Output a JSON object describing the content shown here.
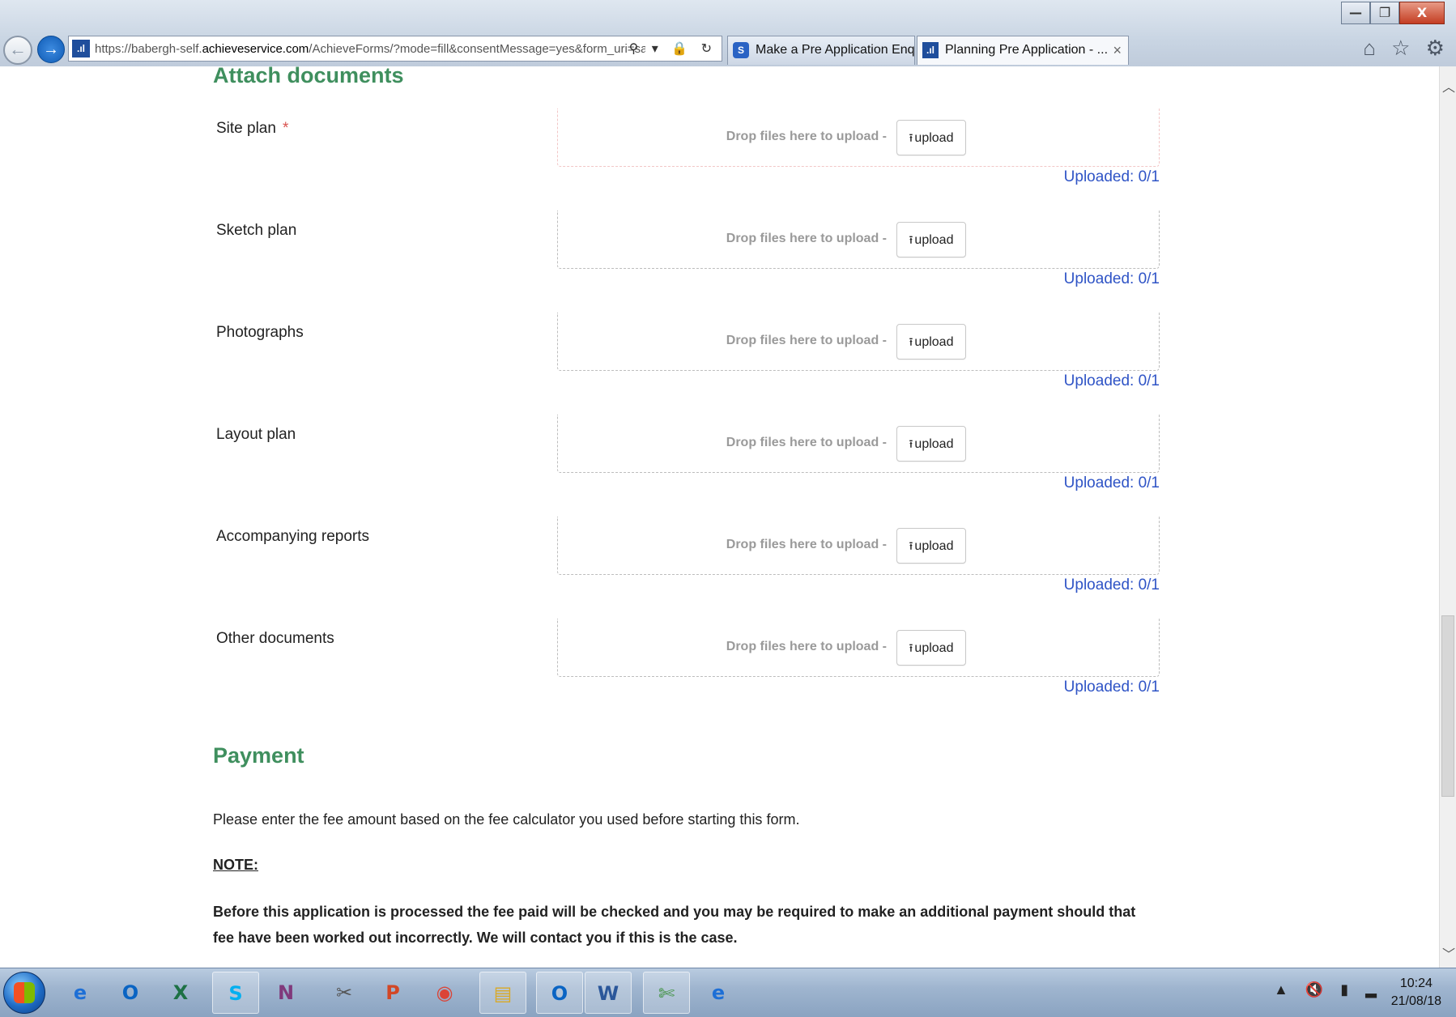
{
  "browser": {
    "url_prefix": "https://babergh-self.",
    "url_domain": "achieveservice.com",
    "url_rest": "/AchieveForms/?mode=fill&consentMessage=yes&form_uri=sandbox",
    "address_tools": "⚲ ▾ 🔒 ↻",
    "tabs": [
      {
        "label": "Make a Pre Application Enquir...",
        "icon": "s-logo-icon"
      },
      {
        "label": "Planning Pre Application - ...",
        "icon": "bar-logo-icon",
        "close": "×"
      }
    ],
    "window_controls": {
      "minimize": "—",
      "restore": "❐",
      "close": "X"
    },
    "toolbar_icons": "⌂ ☆ ⚙"
  },
  "form": {
    "attach_title": "Attach documents",
    "drop_text": "Drop files here to upload -",
    "upload_label": "upload",
    "upload_icon": "⭱",
    "required_mark": "*",
    "fields": [
      {
        "label": "Site plan",
        "required": true,
        "status": "Uploaded: 0/1"
      },
      {
        "label": "Sketch plan",
        "required": false,
        "status": "Uploaded: 0/1"
      },
      {
        "label": "Photographs",
        "required": false,
        "status": "Uploaded: 0/1"
      },
      {
        "label": "Layout plan",
        "required": false,
        "status": "Uploaded: 0/1"
      },
      {
        "label": "Accompanying reports",
        "required": false,
        "status": "Uploaded: 0/1"
      },
      {
        "label": "Other documents",
        "required": false,
        "status": "Uploaded: 0/1"
      }
    ],
    "payment_title": "Payment",
    "payment_intro": "Please enter the fee amount based on the fee calculator you used before starting this form.",
    "note_label": "NOTE:",
    "note_text": "Before this application is processed the fee paid will be checked and you may be required to make an additional payment should that fee have been worked out incorrectly.  We will contact you if this is the case."
  },
  "taskbar": {
    "apps": [
      {
        "name": "internet-explorer",
        "glyph": "e",
        "color": "#1d6fd6"
      },
      {
        "name": "outlook",
        "glyph": "O",
        "color": "#0a64c3"
      },
      {
        "name": "excel",
        "glyph": "X",
        "color": "#1e7145"
      },
      {
        "name": "skype",
        "glyph": "S",
        "color": "#00aff0"
      },
      {
        "name": "onenote",
        "glyph": "N",
        "color": "#80397b"
      },
      {
        "name": "tool",
        "glyph": "✂",
        "color": "#555555"
      },
      {
        "name": "powerpoint",
        "glyph": "P",
        "color": "#d24726"
      },
      {
        "name": "chrome",
        "glyph": "◉",
        "color": "#db4437"
      },
      {
        "name": "file-explorer",
        "glyph": "▤",
        "color": "#d9a926"
      },
      {
        "name": "outlook-2",
        "glyph": "O",
        "color": "#0a64c3"
      },
      {
        "name": "word",
        "glyph": "W",
        "color": "#2b579a"
      },
      {
        "name": "snipping-tool",
        "glyph": "✄",
        "color": "#3a8f3a"
      },
      {
        "name": "internet-explorer-2",
        "glyph": "e",
        "color": "#1d6fd6"
      }
    ],
    "tray_icons": "▲ 🔇 ▮ ▂",
    "time": "10:24",
    "date": "21/08/18"
  }
}
